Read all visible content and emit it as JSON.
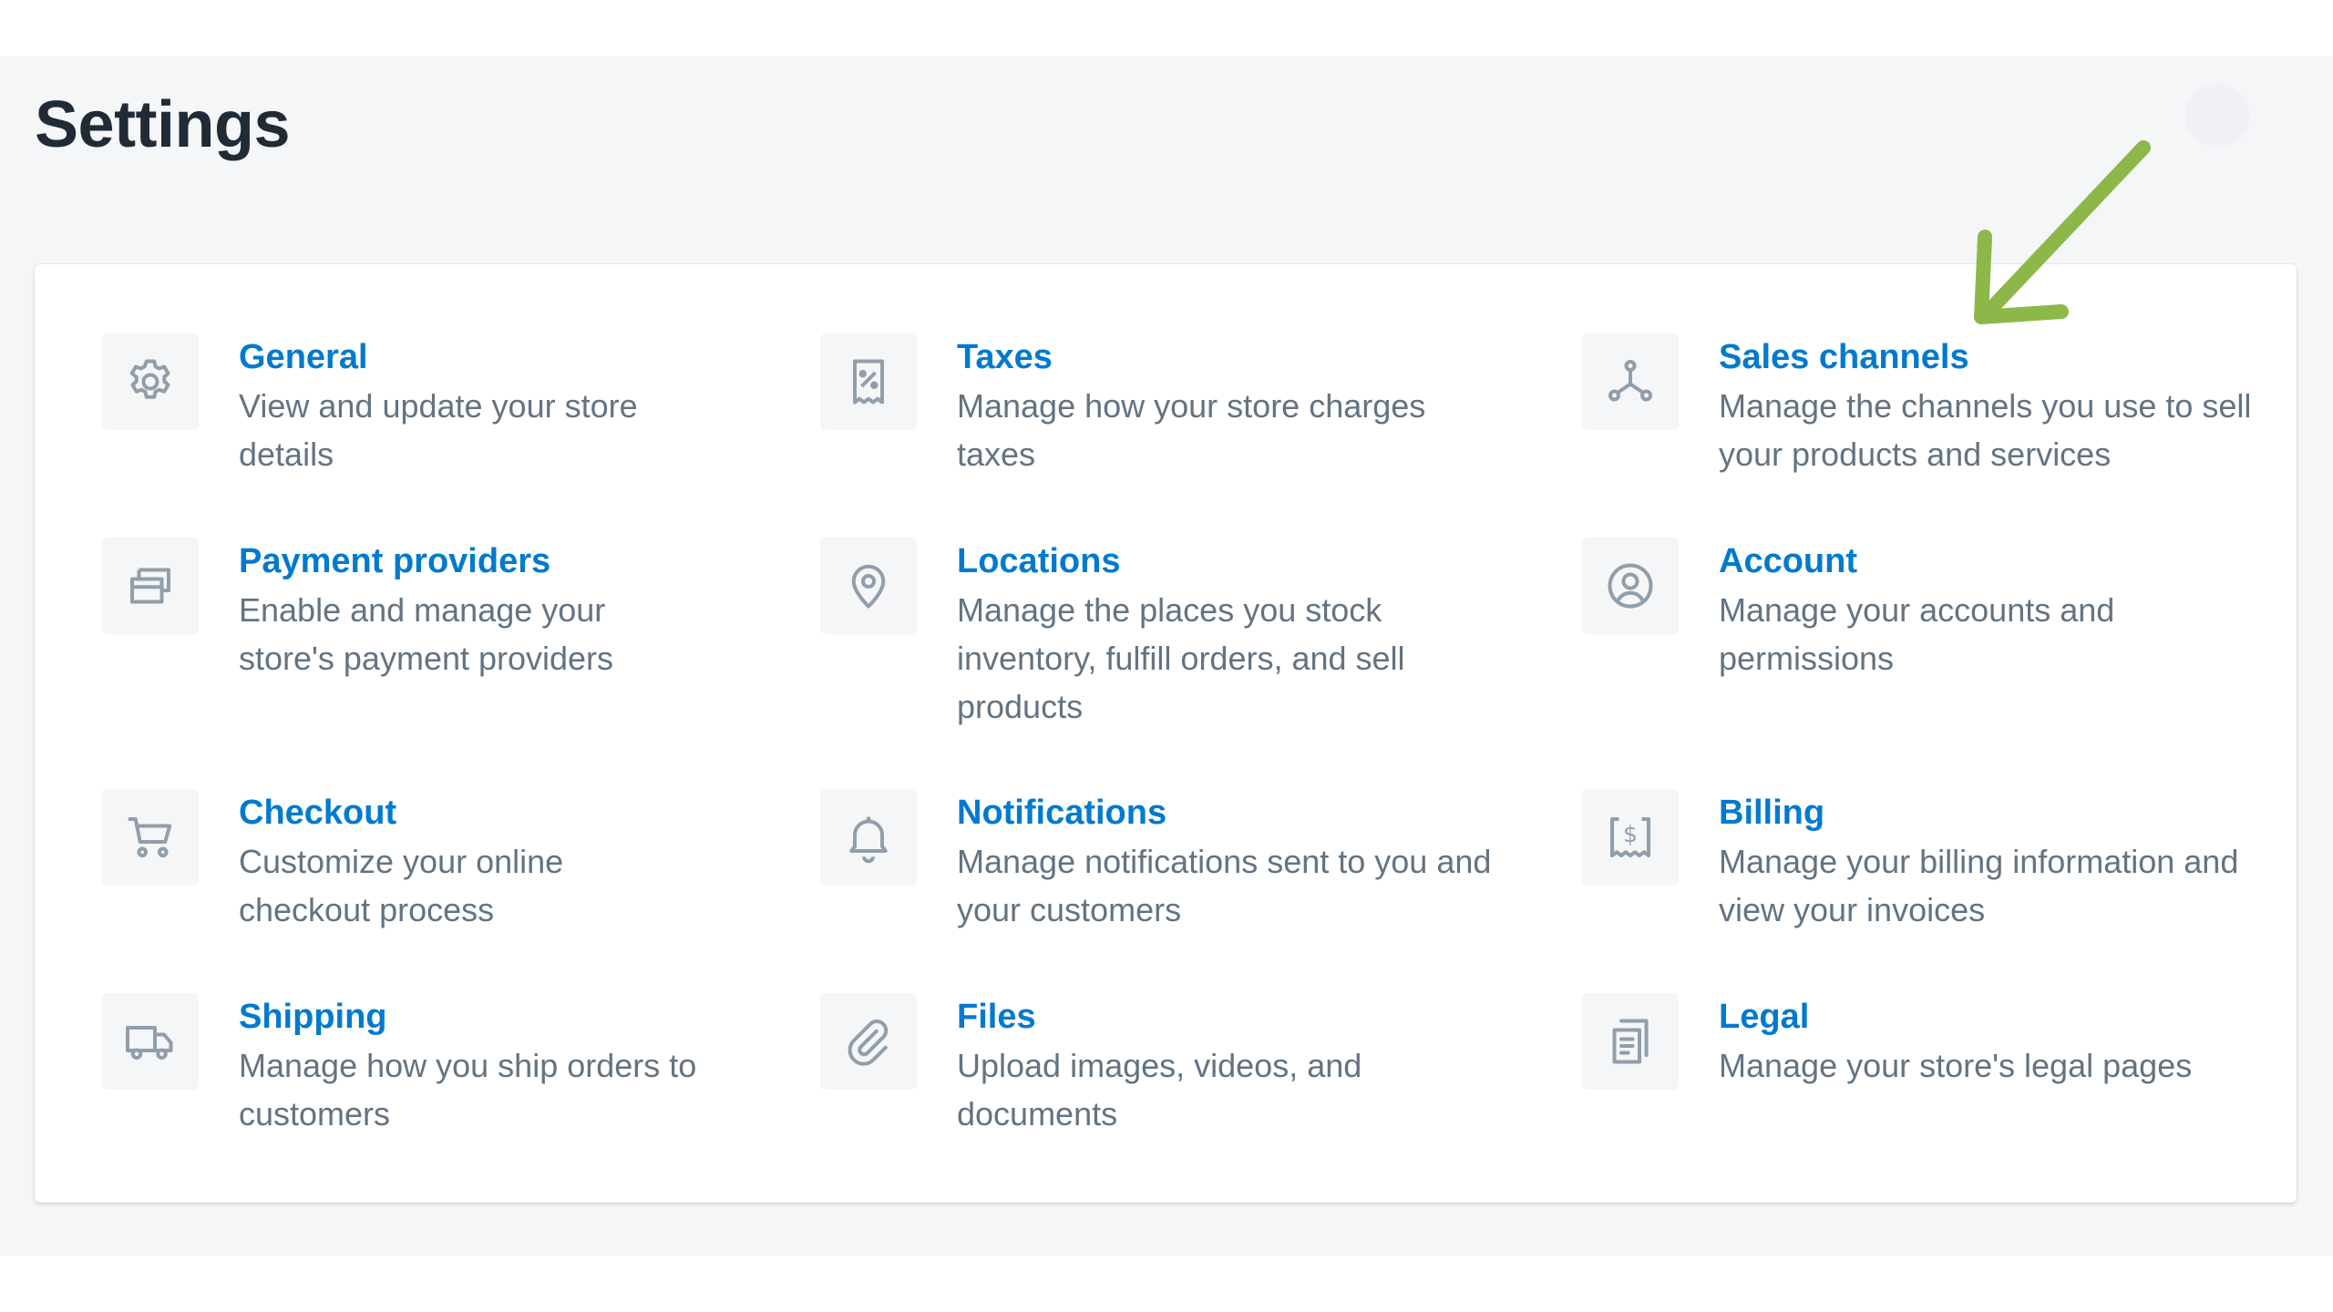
{
  "page": {
    "title": "Settings"
  },
  "colors": {
    "link": "#007ace",
    "text_subdued": "#637381",
    "title_text": "#212b36",
    "icon_gray": "#919eab",
    "icon_bg": "#f4f6f8",
    "annotation_arrow": "#8cb84a"
  },
  "settings": {
    "items": [
      {
        "icon": "gear-icon",
        "title": "General",
        "description": "View and update your store details"
      },
      {
        "icon": "receipt-percent-icon",
        "title": "Taxes",
        "description": "Manage how your store charges taxes"
      },
      {
        "icon": "sales-channels-icon",
        "title": "Sales channels",
        "description": "Manage the channels you use to sell your products and services"
      },
      {
        "icon": "payment-card-icon",
        "title": "Payment providers",
        "description": "Enable and manage your store's payment providers"
      },
      {
        "icon": "location-pin-icon",
        "title": "Locations",
        "description": "Manage the places you stock inventory, fulfill orders, and sell products"
      },
      {
        "icon": "user-circle-icon",
        "title": "Account",
        "description": "Manage your accounts and permissions"
      },
      {
        "icon": "cart-icon",
        "title": "Checkout",
        "description": "Customize your online checkout process"
      },
      {
        "icon": "bell-icon",
        "title": "Notifications",
        "description": "Manage notifications sent to you and your customers"
      },
      {
        "icon": "billing-receipt-icon",
        "title": "Billing",
        "description": "Manage your billing information and view your invoices"
      },
      {
        "icon": "truck-icon",
        "title": "Shipping",
        "description": "Manage how you ship orders to customers"
      },
      {
        "icon": "paperclip-icon",
        "title": "Files",
        "description": "Upload images, videos, and documents"
      },
      {
        "icon": "legal-document-icon",
        "title": "Legal",
        "description": "Manage your store's legal pages"
      }
    ]
  }
}
